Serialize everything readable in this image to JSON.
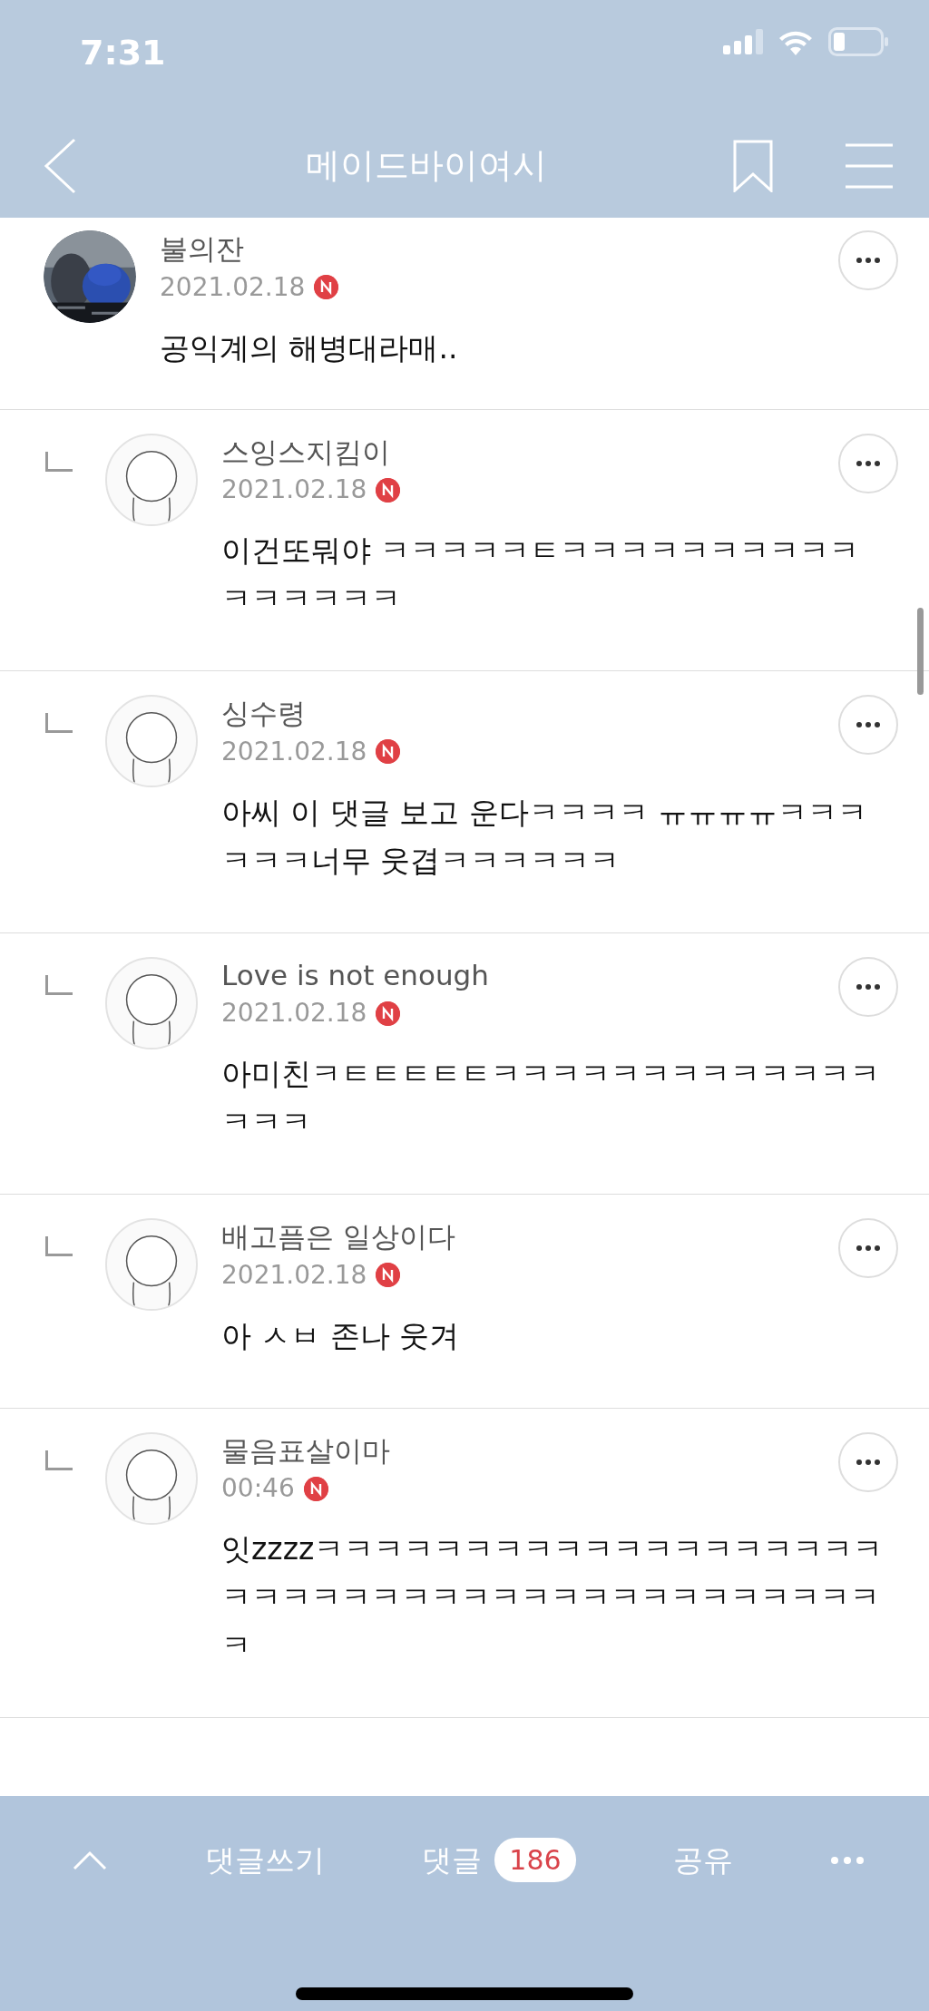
{
  "status_bar": {
    "time": "7:31"
  },
  "header": {
    "title": "메이드바이여시"
  },
  "comments": [
    {
      "reply": false,
      "kind": "picture",
      "author": "불의잔",
      "date": "2021.02.18",
      "new": true,
      "text": "공익계의 해병대라매.."
    },
    {
      "reply": true,
      "kind": "illustration",
      "author": "스잉스지킴이",
      "date": "2021.02.18",
      "new": true,
      "text": "이건또뭐야 ㅋㅋㅋㅋㅋㅌㅋㅋㅋㅋㅋㅋㅋㅋㅋㅋㅋㅋㅋㅋㅋㅋ"
    },
    {
      "reply": true,
      "kind": "illustration",
      "author": "싱수령",
      "date": "2021.02.18",
      "new": true,
      "text": "아씨 이 댓글 보고 운다ㅋㅋㅋㅋ ㅠㅠㅠㅠㅋㅋㅋㅋㅋㅋ너무 웃겹ㅋㅋㅋㅋㅋㅋ"
    },
    {
      "reply": true,
      "kind": "illustration",
      "author": "Love is not enough",
      "date": "2021.02.18",
      "new": true,
      "text": "아미친ㅋㅌㅌㅌㅌㅌㅋㅋㅋㅋㅋㅋㅋㅋㅋㅋㅋㅋㅋㅋㅋㅋ"
    },
    {
      "reply": true,
      "kind": "illustration",
      "author": "배고픔은 일상이다",
      "date": "2021.02.18",
      "new": true,
      "text": "아 ㅅㅂ 존나 웃겨"
    },
    {
      "reply": true,
      "kind": "illustration",
      "author": "물음표살이마",
      "date": "00:46",
      "new": true,
      "text": "잇zzzzㅋㅋㅋㅋㅋㅋㅋㅋㅋㅋㅋㅋㅋㅋㅋㅋㅋㅋㅋㅋㅋㅋㅋㅋㅋㅋㅋㅋㅋㅋㅋㅋㅋㅋㅋㅋㅋㅋㅋㅋㅋㅋ"
    }
  ],
  "bottom_bar": {
    "write": "댓글쓰기",
    "comments": "댓글",
    "count": "186",
    "share": "공유"
  }
}
